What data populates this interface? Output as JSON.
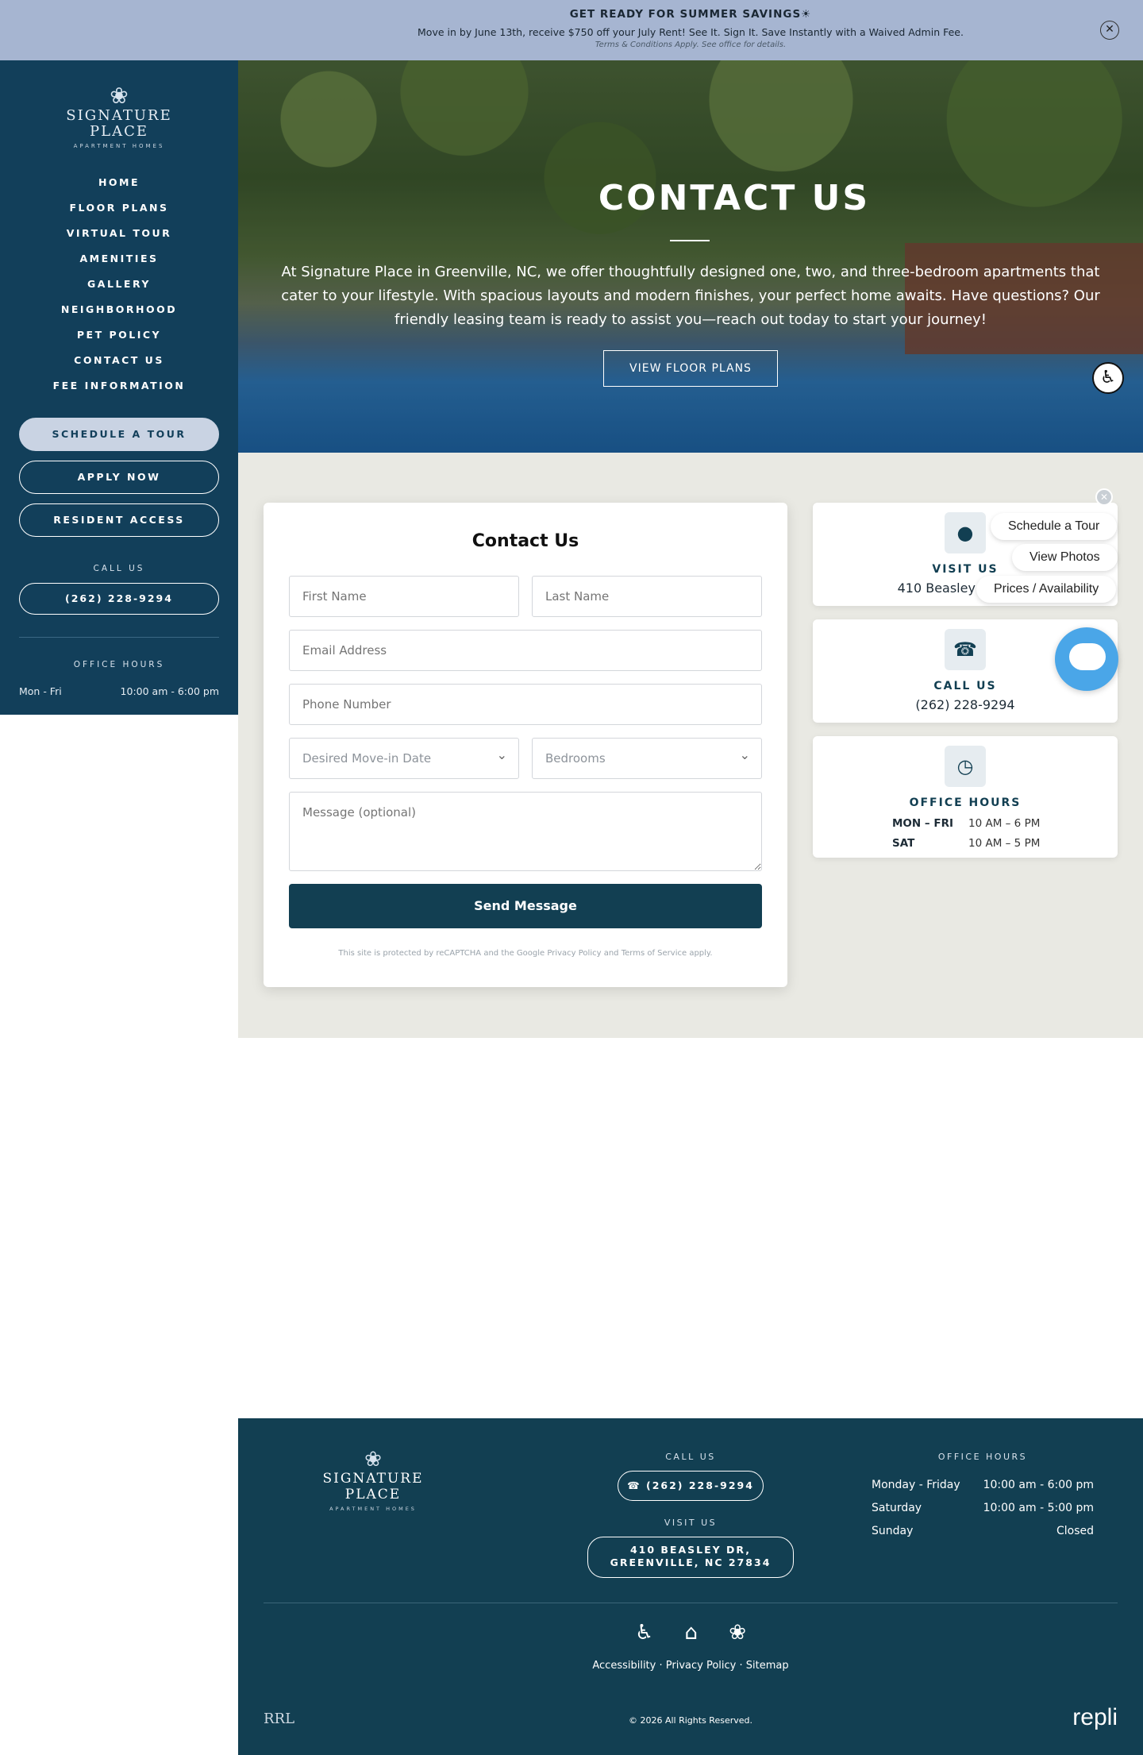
{
  "banner": {
    "title": "GET READY FOR SUMMER SAVINGS☀",
    "text": "Move in by June 13th, receive $750 off your July Rent! See It. Sign It. Save Instantly with a Waived Admin Fee.",
    "terms": "Terms & Conditions Apply. See office for details.",
    "close": "✕"
  },
  "sidebar": {
    "logo": {
      "lotus": "❀",
      "line1": "SIGNATURE",
      "line2": "PLACE",
      "tagline": "APARTMENT HOMES"
    },
    "nav": [
      "HOME",
      "FLOOR PLANS",
      "VIRTUAL TOUR",
      "AMENITIES",
      "GALLERY",
      "NEIGHBORHOOD",
      "PET POLICY",
      "CONTACT US",
      "FEE INFORMATION"
    ],
    "buttons": {
      "schedule": "SCHEDULE A TOUR",
      "apply": "APPLY NOW",
      "resident": "RESIDENT ACCESS"
    },
    "call_label": "CALL US",
    "phone": "(262) 228-9294",
    "hours_label": "OFFICE HOURS",
    "hours_day": "Mon - Fri",
    "hours_time": "10:00 am - 6:00 pm"
  },
  "hero": {
    "title": "CONTACT US",
    "text": "At Signature Place in Greenville, NC, we offer thoughtfully designed one, two, and three-bedroom apartments that cater to your lifestyle. With spacious layouts and modern finishes, your perfect home awaits. Have questions? Our friendly leasing team is ready to assist you—reach out today to start your journey!",
    "button": "VIEW FLOOR PLANS",
    "a11y_icon": "♿"
  },
  "form": {
    "title": "Contact Us",
    "first_name": "First Name",
    "last_name": "Last Name",
    "email": "Email Address",
    "phone": "Phone Number",
    "move_in": "Desired Move-in Date",
    "bedrooms": "Bedrooms",
    "message": "Message (optional)",
    "submit": "Send Message",
    "recaptcha_pre": "This site is protected by reCAPTCHA and the Google",
    "privacy": "Privacy Policy",
    "and": "and",
    "terms": "Terms of Service",
    "apply": "apply."
  },
  "info": {
    "visit": {
      "icon": "location-pin-icon",
      "label": "VISIT US",
      "value": "410 Beasley Dr, Gree"
    },
    "call": {
      "icon": "phone-icon",
      "label": "CALL US",
      "value": "(262) 228-9294"
    },
    "hours": {
      "icon": "clock-icon",
      "label": "OFFICE HOURS",
      "rows": [
        {
          "day": "MON – FRI",
          "time": "10 AM – 6 PM"
        },
        {
          "day": "SAT",
          "time": "10 AM – 5 PM"
        }
      ]
    }
  },
  "widget": {
    "close": "✕",
    "schedule": "Schedule a Tour",
    "photos": "View Photos",
    "prices": "Prices / Availability"
  },
  "footer": {
    "logo": {
      "lotus": "❀",
      "line1": "SIGNATURE",
      "line2": "PLACE",
      "tagline": "APARTMENT HOMES"
    },
    "call_label": "CALL US",
    "phone": "(262) 228-9294",
    "visit_label": "VISIT US",
    "address_line1": "410 BEASLEY DR,",
    "address_line2": "GREENVILLE, NC 27834",
    "hours_label": "OFFICE HOURS",
    "hours": [
      {
        "day": "Monday - Friday",
        "time": "10:00 am - 6:00 pm"
      },
      {
        "day": "Saturday",
        "time": "10:00 am - 5:00 pm"
      },
      {
        "day": "Sunday",
        "time": "Closed"
      }
    ],
    "links": {
      "accessibility": "Accessibility",
      "privacy": "Privacy Policy",
      "sitemap": "Sitemap",
      "sep": " · "
    },
    "copyright": "© 2026 All Rights Reserved.",
    "rrl": "RRL",
    "repli": "repli"
  },
  "colors": {
    "navy": "#123f5a",
    "footer": "#123f52",
    "banner": "#a6b5d1",
    "chat": "#4aa6e8"
  }
}
